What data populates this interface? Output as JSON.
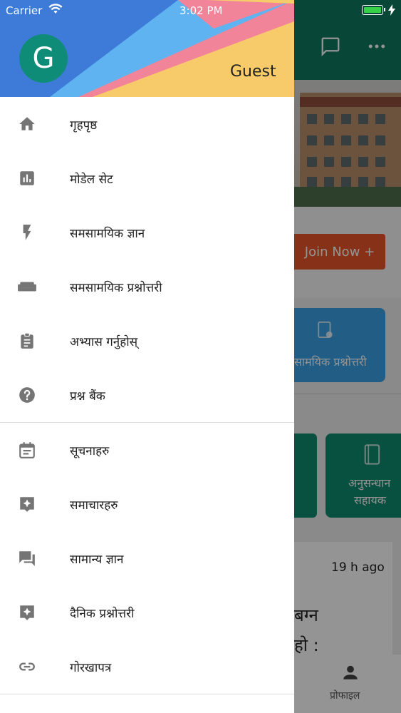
{
  "status_bar": {
    "carrier": "Carrier",
    "time": "3:02 PM"
  },
  "drawer": {
    "avatar_letter": "G",
    "user_name": "Guest",
    "header_colors": [
      "#3e7bd8",
      "#5fb3f0",
      "#f2849a",
      "#f8cb6a"
    ],
    "items_primary": [
      {
        "label": "गृहपृष्ठ",
        "icon": "home-icon"
      },
      {
        "label": "मोडेल सेट",
        "icon": "bar-chart-icon"
      },
      {
        "label": "समसामयिक ज्ञान",
        "icon": "flash-icon"
      },
      {
        "label": "समसामयिक प्रश्नोत्तरी",
        "icon": "sofa-icon"
      },
      {
        "label": "अभ्यास गर्नुहोस्",
        "icon": "clipboard-icon"
      },
      {
        "label": "प्रश्न बैंक",
        "icon": "help-circle-icon"
      }
    ],
    "items_secondary": [
      {
        "label": "सूचनाहरु",
        "icon": "event-note-icon"
      },
      {
        "label": "समाचारहरु",
        "icon": "sparkle-note-icon"
      },
      {
        "label": "सामान्य ज्ञान",
        "icon": "chat-icon"
      },
      {
        "label": "दैनिक प्रश्नोत्तरी",
        "icon": "sparkle-note-icon"
      },
      {
        "label": "गोरखापत्र",
        "icon": "link-icon"
      }
    ]
  },
  "background": {
    "join_button": "Join Now +",
    "card_label": "सामयिक प्रश्नोत्तरी",
    "card2_label_line1": "अनुसन्धान",
    "card2_label_line2": "सहायक",
    "news_time": "19 h ago",
    "news_line1": "बग्न",
    "news_line2": "हो :",
    "bottom_nav_label": "प्रोफाइल"
  },
  "colors": {
    "primary": "#0e7a5f",
    "accent": "#e8562a",
    "card_blue": "#3aa0e6",
    "icon_gray": "#757575"
  }
}
